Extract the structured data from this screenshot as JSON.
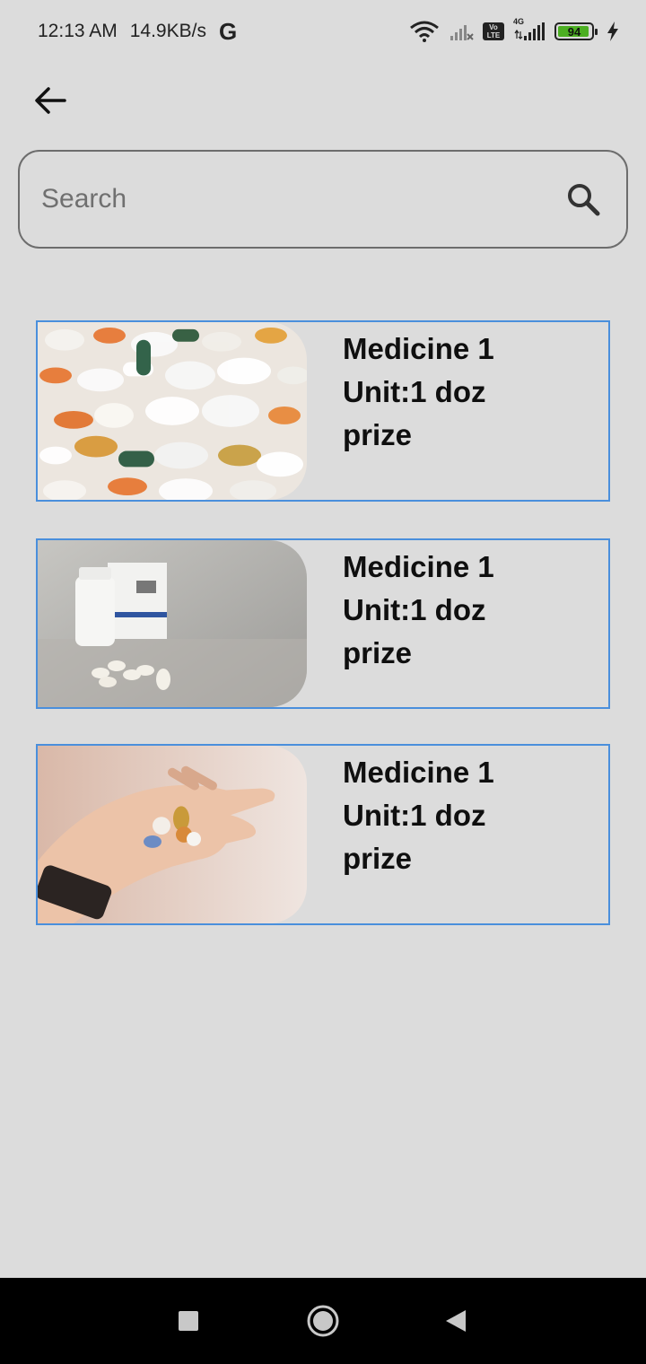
{
  "status_bar": {
    "time": "12:13 AM",
    "net_speed": "14.9KB/s",
    "g_logo": "G",
    "volte": "Vo LTE",
    "network_type": "4G",
    "battery_level": "94"
  },
  "search": {
    "placeholder": "Search"
  },
  "medicines": [
    {
      "name": "Medicine 1",
      "unit": "Unit:1 doz",
      "price_label": "prize"
    },
    {
      "name": "Medicine 1",
      "unit": "Unit:1 doz",
      "price_label": "prize"
    },
    {
      "name": "Medicine 1",
      "unit": "Unit:1 doz",
      "price_label": "prize"
    }
  ],
  "colors": {
    "background": "#dcdcdc",
    "card_border": "#4a8fdc",
    "battery_fill": "#4caf22"
  },
  "icons": [
    "back-arrow-icon",
    "search-icon",
    "recents-square-icon",
    "home-circle-icon",
    "back-triangle-icon",
    "wifi-icon",
    "signal-icon",
    "charging-bolt-icon"
  ]
}
